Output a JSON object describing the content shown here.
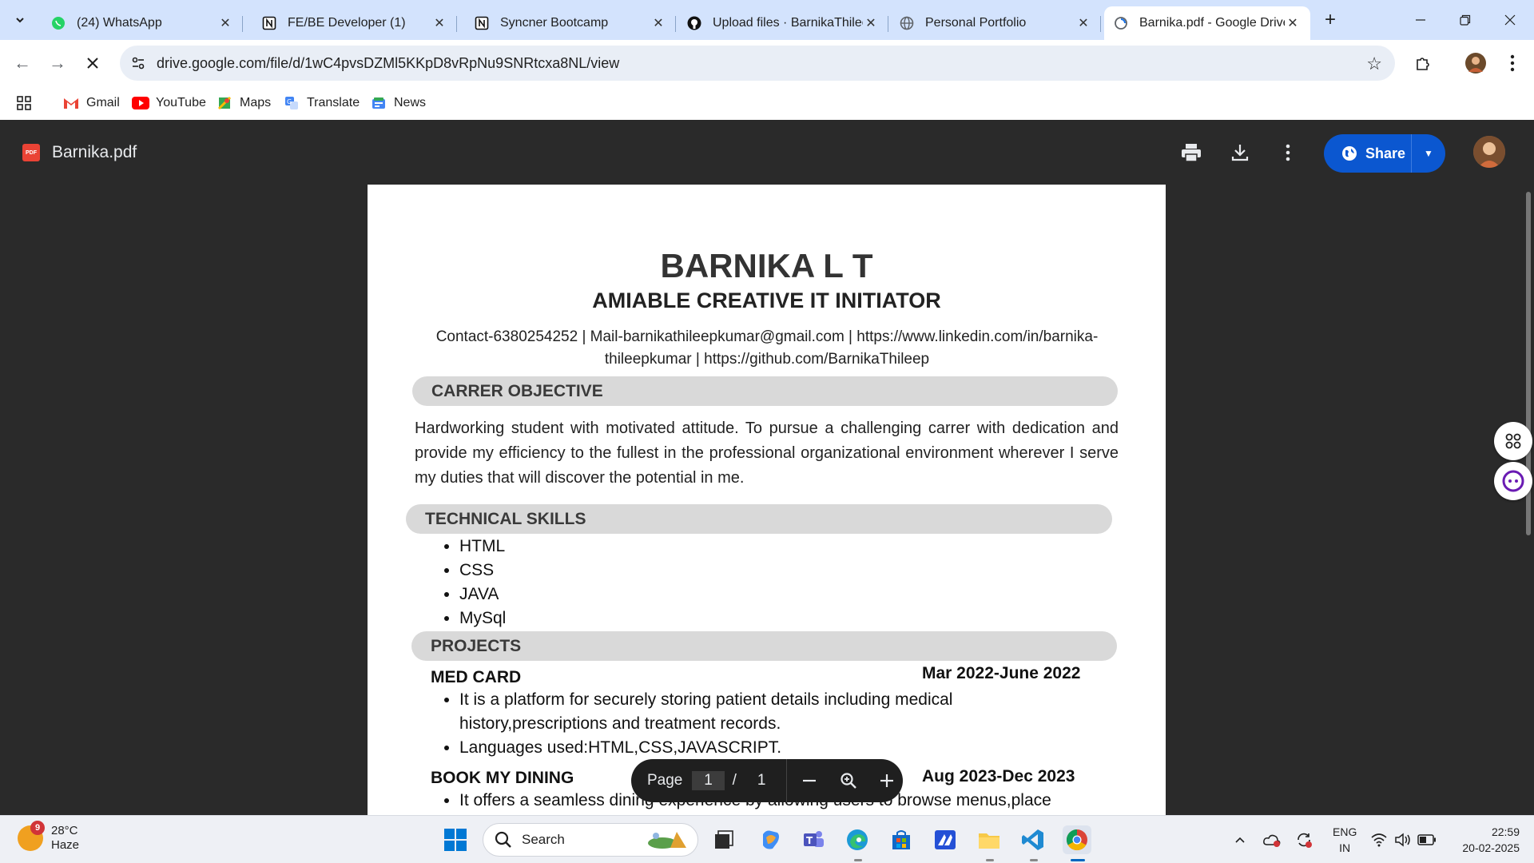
{
  "browser": {
    "tabs": [
      {
        "label": "(24) WhatsApp",
        "icon": "whatsapp-icon"
      },
      {
        "label": "FE/BE Developer (1)",
        "icon": "notion-icon"
      },
      {
        "label": "Syncner Bootcamp",
        "icon": "notion-icon"
      },
      {
        "label": "Upload files · BarnikaThileep",
        "icon": "github-icon"
      },
      {
        "label": "Personal Portfolio",
        "icon": "globe-icon"
      },
      {
        "label": "Barnika.pdf - Google Drive",
        "icon": "drive-icon",
        "active": true
      }
    ],
    "url": "drive.google.com/file/d/1wC4pvsDZMl5KKpD8vRpNu9SNRtcxa8NL/view",
    "bookmarks": [
      {
        "label": "Gmail",
        "icon": "gmail-icon"
      },
      {
        "label": "YouTube",
        "icon": "youtube-icon"
      },
      {
        "label": "Maps",
        "icon": "maps-icon"
      },
      {
        "label": "Translate",
        "icon": "translate-icon"
      },
      {
        "label": "News",
        "icon": "news-icon"
      }
    ]
  },
  "viewer": {
    "file_name": "Barnika.pdf",
    "file_badge": "PDF",
    "share_label": "Share",
    "page_label": "Page",
    "current_page": "1",
    "page_sep": "/",
    "total_pages": "1"
  },
  "resume": {
    "name": "BARNIKA L T",
    "headline": "AMIABLE CREATIVE IT INITIATOR",
    "contact": "Contact-6380254252 | Mail-barnikathileepkumar@gmail.com | https://www.linkedin.com/in/barnika-thileepkumar |  https://github.com/BarnikaThileep",
    "objective_heading": "CARRER OBJECTIVE",
    "objective": "Hardworking student with motivated attitude. To pursue a challenging carrer with dedication and provide my efficiency to the fullest in the professional organizational environment wherever I serve my duties that will discover the potential in me.",
    "skills_heading": "TECHNICAL SKILLS",
    "skills": [
      "HTML",
      "CSS",
      "JAVA",
      "MySql"
    ],
    "projects_heading": "PROJECTS",
    "projects": [
      {
        "title": "MED CARD",
        "date": "Mar 2022-June 2022",
        "points": [
          "It is a platform for securely storing patient details including medical history,prescriptions and treatment records.",
          "Languages used:HTML,CSS,JAVASCRIPT."
        ]
      },
      {
        "title": "BOOK MY DINING",
        "date": "Aug 2023-Dec 2023",
        "points": [
          "It offers a seamless dining experience by allowing users to browse menus,place"
        ]
      }
    ]
  },
  "taskbar": {
    "weather_badge": "9",
    "temperature": "28°C",
    "condition": "Haze",
    "search_placeholder": "Search",
    "lang_line1": "ENG",
    "lang_line2": "IN",
    "time": "22:59",
    "date": "20-02-2025"
  },
  "colors": {
    "tabstrip": "#d3e3fd",
    "viewer_bg": "#2a2a2a",
    "share_button": "#0b57d0",
    "section_bar": "#d9d9d9"
  }
}
